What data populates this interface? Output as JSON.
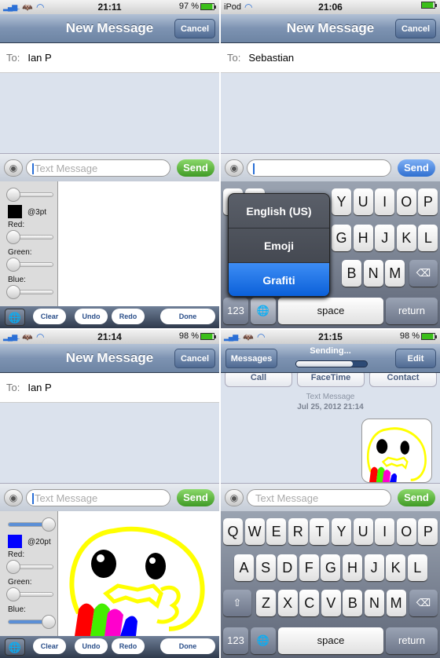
{
  "colors": {
    "send_green": "#5ab83a",
    "send_blue": "#3a7fe0",
    "selected_blue": "#0a5fd8",
    "pen_black": "#000000",
    "pen_blue": "#0000ff"
  },
  "panes": [
    {
      "status": {
        "left": "",
        "time": "21:11",
        "battery": "97 %"
      },
      "nav": {
        "title": "New Message",
        "cancel": "Cancel"
      },
      "to": {
        "label": "To:",
        "value": "Ian P"
      },
      "input": {
        "placeholder": "Text Message",
        "send": "Send"
      },
      "draw": {
        "size_label": "@3pt",
        "size_level": 0,
        "red_label": "Red:",
        "green_label": "Green:",
        "blue_label": "Blue:",
        "red": 0,
        "green": 0,
        "blue": 0
      },
      "toolbar": {
        "clear": "Clear",
        "undo": "Undo",
        "redo": "Redo",
        "done": "Done"
      }
    },
    {
      "status": {
        "left": "iPod",
        "time": "21:06",
        "battery": ""
      },
      "nav": {
        "title": "New Message",
        "cancel": "Cancel"
      },
      "to": {
        "label": "To:",
        "value": "Sebastian"
      },
      "input": {
        "placeholder": "",
        "send": "Send"
      },
      "keyboard": {
        "row1": [
          "Y",
          "U",
          "I",
          "O",
          "P"
        ],
        "row2": [
          "G",
          "H",
          "J",
          "K",
          "L"
        ],
        "row3": [
          "B",
          "N",
          "M"
        ],
        "num": "123",
        "space": "space",
        "return": "return"
      },
      "language_menu": [
        "English (US)",
        "Emoji",
        "Grafiti"
      ],
      "language_selected": "Grafiti"
    },
    {
      "status": {
        "left": "",
        "time": "21:14",
        "battery": "98 %"
      },
      "nav": {
        "title": "New Message",
        "cancel": "Cancel"
      },
      "to": {
        "label": "To:",
        "value": "Ian P"
      },
      "input": {
        "placeholder": "Text Message",
        "send": "Send"
      },
      "draw": {
        "size_label": "@20pt",
        "size_level": 1,
        "red_label": "Red:",
        "green_label": "Green:",
        "blue_label": "Blue:",
        "red": 0,
        "green": 0,
        "blue": 1
      },
      "toolbar": {
        "clear": "Clear",
        "undo": "Undo",
        "redo": "Redo",
        "done": "Done"
      }
    },
    {
      "status": {
        "left": "",
        "time": "21:15",
        "battery": "98 %"
      },
      "nav": {
        "back": "Messages",
        "title": "Sending...",
        "edit": "Edit",
        "progress": 0.8
      },
      "actions": [
        "Call",
        "FaceTime",
        "Contact"
      ],
      "meta": {
        "type": "Text Message",
        "date": "Jul 25, 2012 21:14"
      },
      "input": {
        "placeholder": "Text Message",
        "send": "Send"
      },
      "keyboard": {
        "row1": [
          "Q",
          "W",
          "E",
          "R",
          "T",
          "Y",
          "U",
          "I",
          "O",
          "P"
        ],
        "row2": [
          "A",
          "S",
          "D",
          "F",
          "G",
          "H",
          "J",
          "K",
          "L"
        ],
        "row3": [
          "Z",
          "X",
          "C",
          "V",
          "B",
          "N",
          "M"
        ],
        "num": "123",
        "space": "space",
        "return": "return"
      }
    }
  ]
}
